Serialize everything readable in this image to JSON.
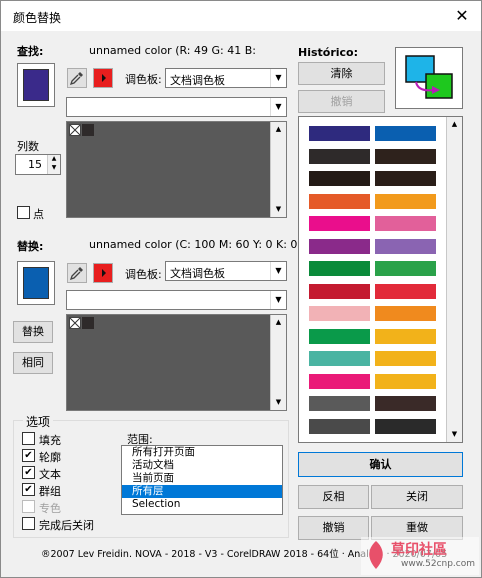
{
  "window": {
    "title": "颜色替换",
    "close_glyph": "✕"
  },
  "find": {
    "label": "查找:",
    "color_info": "unnamed color (R: 49 G: 41 B:",
    "swatch_color": "#3a2a8a",
    "palette_label": "调色板:",
    "palette_value": "文档调色板",
    "columns_label": "列数",
    "columns_value": "15",
    "dot_label": "点"
  },
  "replace": {
    "label": "替换:",
    "color_info": "unnamed color (C: 100 M: 60 Y: 0 K: 0)",
    "swatch_color": "#0a5fb0",
    "palette_label": "调色板:",
    "palette_value": "文档调色板",
    "replace_btn": "替换",
    "same_btn": "相同"
  },
  "history": {
    "label": "Histórico:",
    "clear_btn": "清除",
    "undo_btn": "撤销",
    "rows": [
      [
        "#2e2a7e",
        "#0a5fb0"
      ],
      [
        "#2e2a2a",
        "#2e221c"
      ],
      [
        "#231a16",
        "#2a1e18"
      ],
      [
        "#e55a28",
        "#f29a1c"
      ],
      [
        "#ea0e8c",
        "#e2609a"
      ],
      [
        "#8a2a8a",
        "#8a64b2"
      ],
      [
        "#0a8a3a",
        "#2aa24a"
      ],
      [
        "#c41a30",
        "#e22a3a"
      ],
      [
        "#f2b2b6",
        "#f08a1e"
      ],
      [
        "#0a9a4a",
        "#f2b21a"
      ],
      [
        "#4ab4a2",
        "#f2b21a"
      ],
      [
        "#ea1a78",
        "#f2b21a"
      ],
      [
        "#5a5a5a",
        "#3a2a28"
      ],
      [
        "#4a4a4a",
        "#2a2a2a"
      ]
    ]
  },
  "options": {
    "title": "选项",
    "items": [
      {
        "label": "填充",
        "checked": false,
        "disabled": false
      },
      {
        "label": "轮廓",
        "checked": true,
        "disabled": false
      },
      {
        "label": "文本",
        "checked": true,
        "disabled": false
      },
      {
        "label": "群组",
        "checked": true,
        "disabled": false
      },
      {
        "label": "专色",
        "checked": false,
        "disabled": true
      },
      {
        "label": "完成后关闭",
        "checked": false,
        "disabled": false
      }
    ],
    "scope_label": "范围:",
    "scope_items": [
      "所有打开页面",
      "活动文档",
      "当前页面",
      "所有层",
      "Selection"
    ],
    "scope_selected": 3
  },
  "actions": {
    "confirm": "确认",
    "invert": "反相",
    "close": "关闭",
    "undo": "撤销",
    "redo": "重做"
  },
  "footer": {
    "text": "®2007 Lev Freidin. NOVA - 2018 - V3 - CorelDRAW 2018 - 64位 · Analing · 2020/07/05",
    "watermark": "草印社區",
    "watermark_url": "www.52cnp.com"
  }
}
